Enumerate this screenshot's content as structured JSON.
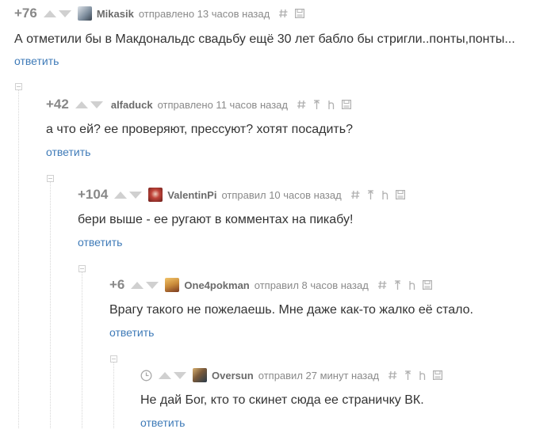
{
  "comments": [
    {
      "rating": "+76",
      "author": "Mikasik",
      "time": "отправлено 13 часов назад",
      "text": "А отметили бы в Макдональдс свадьбу ещё 30 лет бабло бы стригли..понты,понты...",
      "reply": "ответить",
      "avatar_color": "#7a8a9a"
    },
    {
      "rating": "+42",
      "author": "alfaduck",
      "time": "отправлено 11 часов назад",
      "text": "а что ей? ее проверяют, прессуют? хотят посадить?",
      "reply": "ответить"
    },
    {
      "rating": "+104",
      "author": "ValentinPi",
      "time": "отправил 10 часов назад",
      "text": "бери выше - ее ругают в комментах на пикабу!",
      "reply": "ответить",
      "avatar_color": "#a0302a"
    },
    {
      "rating": "+6",
      "author": "One4pokman",
      "time": "отправил 8 часов назад",
      "text": "Врагу такого не пожелаешь. Мне даже как-то жалко её стало.",
      "reply": "ответить",
      "avatar_color": "#c98a3a"
    },
    {
      "rating": "",
      "author": "Oversun",
      "time": "отправил 27 минут назад",
      "text": "Не дай Бог, кто то скинет сюда ее страничку ВК.",
      "reply": "ответить",
      "avatar_color": "#7a5a3a"
    }
  ],
  "colors": {
    "link": "#3f7bb8",
    "rating": "#888888",
    "icon": "#b0b0b0"
  }
}
